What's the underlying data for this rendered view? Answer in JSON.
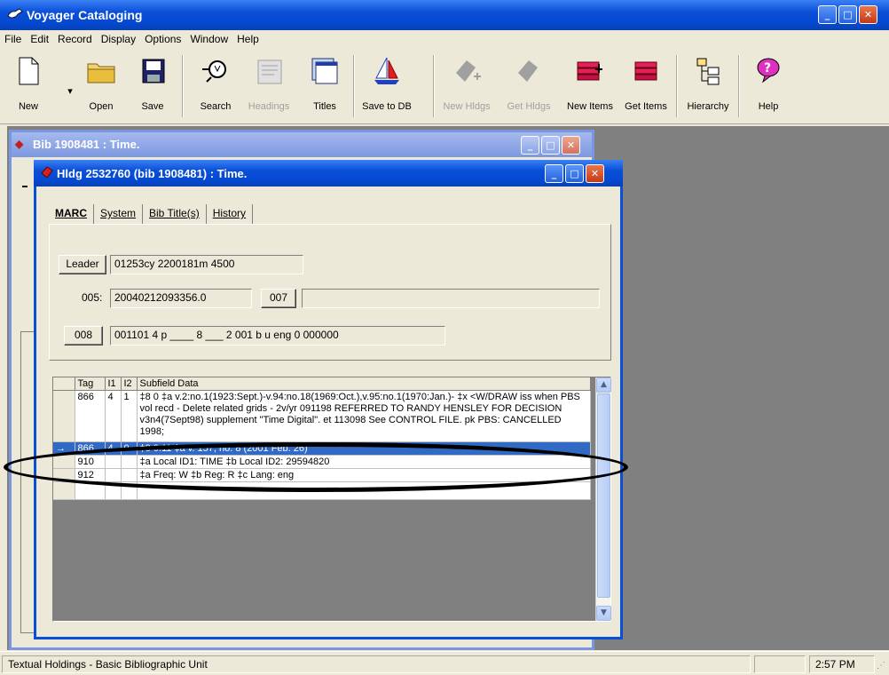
{
  "app": {
    "title": "Voyager Cataloging"
  },
  "menu": [
    "File",
    "Edit",
    "Record",
    "Display",
    "Options",
    "Window",
    "Help"
  ],
  "toolbar": {
    "new": "New",
    "open": "Open",
    "save": "Save",
    "search": "Search",
    "headings": "Headings",
    "titles": "Titles",
    "save_to_db": "Save to DB",
    "new_hldgs": "New Hldgs",
    "get_hldgs": "Get Hldgs",
    "new_items": "New Items",
    "get_items": "Get Items",
    "hierarchy": "Hierarchy",
    "help": "Help"
  },
  "bib_window": {
    "title": "Bib 1908481 : Time."
  },
  "hldg_window": {
    "title": "Hldg 2532760 (bib 1908481) : Time.",
    "tabs": [
      "MARC",
      "System",
      "Bib Title(s)",
      "History"
    ],
    "leader_label": "Leader",
    "leader_value": "01253cy  2200181m  4500",
    "f005_label": "005:",
    "f005_value": "20040212093356.0",
    "f007_label": "007",
    "f007_value": "",
    "f008_label": "008",
    "f008_value": "001101 4 p ____ 8 ___ 2 001 b u eng 0 000000",
    "grid_headers": [
      "Tag",
      "I1",
      "I2",
      "Subfield Data"
    ],
    "rows": [
      {
        "tag": "866",
        "i1": "4",
        "i2": "1",
        "data": "‡8 0 ‡a v.2:no.1(1923:Sept.)-v.94:no.18(1969:Oct.),v.95:no.1(1970:Jan.)- ‡x <W/DRAW iss when PBS vol recd - Delete related grids - 2v/yr 091198 REFERRED TO RANDY HENSLEY FOR DECISION v3n4(7Sept98) supplement \"Time Digital\". et 113098 See CONTROL FILE. pk PBS: CANCELLED 1998;",
        "marker": ""
      },
      {
        "tag": "866",
        "i1": "4",
        "i2": "0",
        "data": "‡8 0.11 ‡a v. 157, no. 8 (2001 Feb. 26)",
        "marker": "→"
      },
      {
        "tag": "910",
        "i1": "",
        "i2": "",
        "data": "‡a Local ID1: TIME ‡b Local ID2: 29594820",
        "marker": ""
      },
      {
        "tag": "912",
        "i1": "",
        "i2": "",
        "data": "‡a Freq: W ‡b Reg: R ‡c Lang: eng",
        "marker": ""
      }
    ]
  },
  "status": {
    "text": "Textual Holdings - Basic Bibliographic Unit",
    "time": "2:57 PM"
  }
}
